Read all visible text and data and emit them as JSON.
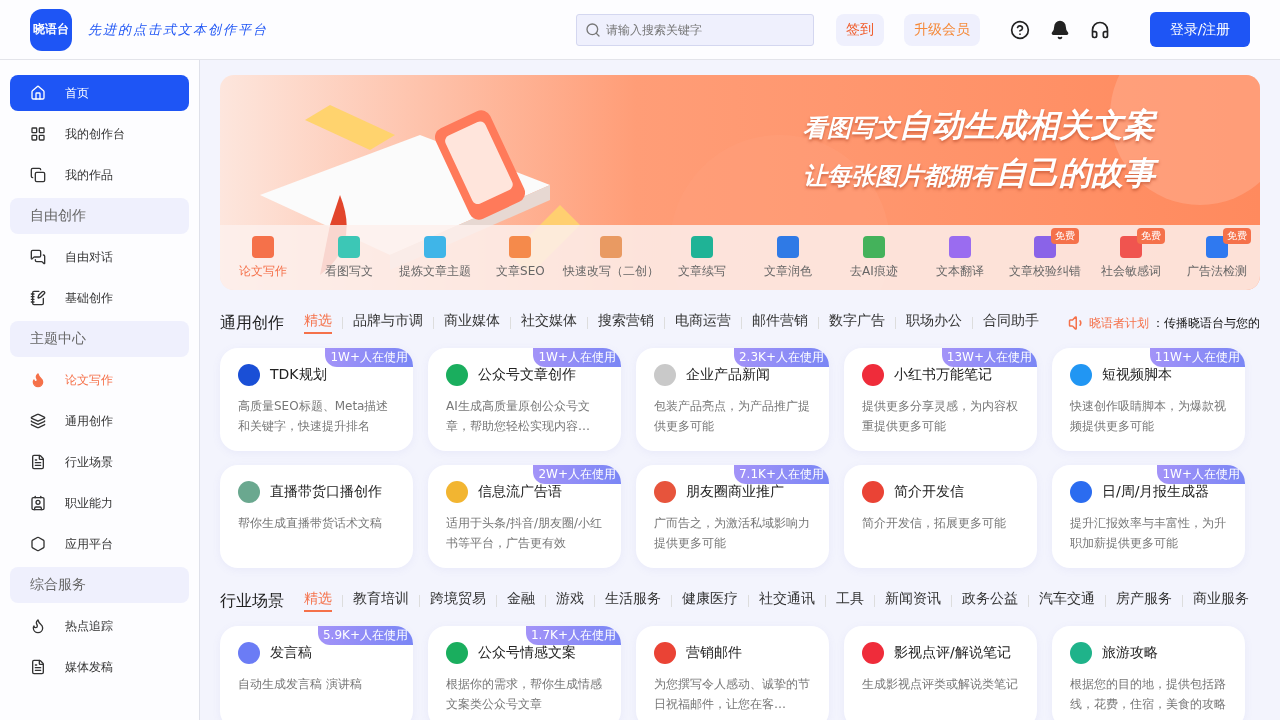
{
  "header": {
    "logo": "晓语台",
    "slogan": "先进的点击式文本创作平台",
    "search": {
      "placeholder": "请输入搜索关键字"
    },
    "checkin": "签到",
    "upgrade": "升级会员",
    "login": "登录/注册"
  },
  "sidebar": {
    "items": [
      {
        "kind": "item",
        "label": "首页",
        "selected": true
      },
      {
        "kind": "item",
        "label": "我的创作台",
        "selected": false
      },
      {
        "kind": "item",
        "label": "我的作品",
        "selected": false
      },
      {
        "kind": "header",
        "label": "自由创作"
      },
      {
        "kind": "item",
        "label": "自由对话",
        "selected": false
      },
      {
        "kind": "item",
        "label": "基础创作",
        "selected": false
      },
      {
        "kind": "header",
        "label": "主题中心"
      },
      {
        "kind": "hot",
        "label": "论文写作",
        "selected": false
      },
      {
        "kind": "item",
        "label": "通用创作",
        "selected": false
      },
      {
        "kind": "item",
        "label": "行业场景",
        "selected": false
      },
      {
        "kind": "item",
        "label": "职业能力",
        "selected": false
      },
      {
        "kind": "item",
        "label": "应用平台",
        "selected": false
      },
      {
        "kind": "header",
        "label": "综合服务"
      },
      {
        "kind": "item",
        "label": "热点追踪",
        "selected": false
      },
      {
        "kind": "item",
        "label": "媒体发稿",
        "selected": false
      }
    ]
  },
  "banner": {
    "line_1": {
      "small": "看图写文",
      "big": "自动生成相关文案"
    },
    "line_2": {
      "small": "让每张图片都拥有",
      "big": "自己的故事"
    },
    "tools": [
      {
        "label": "论文写作",
        "selected": true,
        "color": "#f5714a"
      },
      {
        "label": "看图写文",
        "selected": false,
        "color": "#3cc7b6"
      },
      {
        "label": "提炼文章主题",
        "selected": false,
        "color": "#3fb5e8"
      },
      {
        "label": "文章SEO",
        "selected": false,
        "color": "#f58a4b"
      },
      {
        "label": "快速改写（二创）",
        "selected": false,
        "color": "#e99a62"
      },
      {
        "label": "文章续写",
        "selected": false,
        "color": "#1fb396"
      },
      {
        "label": "文章润色",
        "selected": false,
        "color": "#2f7ae6"
      },
      {
        "label": "去AI痕迹",
        "selected": false,
        "color": "#44b25b"
      },
      {
        "label": "文本翻译",
        "selected": false,
        "color": "#9a6cf0"
      },
      {
        "label": "文章校验纠错",
        "selected": false,
        "color": "#8a63e8",
        "badge": "免费"
      },
      {
        "label": "社会敏感词",
        "selected": false,
        "color": "#f0544f",
        "badge": "免费"
      },
      {
        "label": "广告法检测",
        "selected": false,
        "color": "#2f79f0",
        "badge": "免费"
      }
    ]
  },
  "sections": [
    {
      "title": "通用创作",
      "tabs": [
        {
          "label": "精选",
          "selected": true
        },
        {
          "label": "品牌与市调",
          "selected": false
        },
        {
          "label": "商业媒体",
          "selected": false
        },
        {
          "label": "社交媒体",
          "selected": false
        },
        {
          "label": "搜索营销",
          "selected": false
        },
        {
          "label": "电商运营",
          "selected": false
        },
        {
          "label": "邮件营销",
          "selected": false
        },
        {
          "label": "数字广告",
          "selected": false
        },
        {
          "label": "职场办公",
          "selected": false
        },
        {
          "label": "合同助手",
          "selected": false
        }
      ],
      "notice": {
        "name": "晓语者计划",
        "text": "：传播晓语台与您的"
      },
      "cards": [
        {
          "title": "TDK规划",
          "desc": "高质量SEO标题、Meta描述和关键字，快速提升排名",
          "usage": "1W+人在使用",
          "color": "#1a4fd6"
        },
        {
          "title": "公众号文章创作",
          "desc": "AI生成高质量原创公众号文章，帮助您轻松实现内容…",
          "usage": "1W+人在使用",
          "color": "#1aae5e"
        },
        {
          "title": "企业产品新闻",
          "desc": "包装产品亮点，为产品推广提供更多可能",
          "usage": "2.3K+人在使用",
          "color": "#c9c9c9"
        },
        {
          "title": "小红书万能笔记",
          "desc": "提供更多分享灵感，为内容权重提供更多可能",
          "usage": "13W+人在使用",
          "color": "#ef2c3a"
        },
        {
          "title": "短视频脚本",
          "desc": "快速创作吸睛脚本，为爆款视频提供更多可能",
          "usage": "11W+人在使用",
          "color": "#2196f3"
        },
        {
          "title": "直播带货口播创作",
          "desc": "帮你生成直播带货话术文稿",
          "color": "#6aa88f"
        },
        {
          "title": "信息流广告语",
          "desc": "适用于头条/抖音/朋友圈/小红书等平台，广告更有效",
          "usage": "2W+人在使用",
          "color": "#f2b531"
        },
        {
          "title": "朋友圈商业推广",
          "desc": "广而告之，为激活私域影响力提供更多可能",
          "usage": "7.1K+人在使用",
          "color": "#e7543c"
        },
        {
          "title": "简介开发信",
          "desc": "简介开发信，拓展更多可能",
          "color": "#ea4335"
        },
        {
          "title": "日/周/月报生成器",
          "desc": "提升汇报效率与丰富性，为升职加薪提供更多可能",
          "usage": "1W+人在使用",
          "color": "#2b6cf0"
        }
      ]
    },
    {
      "title": "行业场景",
      "tabs": [
        {
          "label": "精选",
          "selected": true
        },
        {
          "label": "教育培训",
          "selected": false
        },
        {
          "label": "跨境贸易",
          "selected": false
        },
        {
          "label": "金融",
          "selected": false
        },
        {
          "label": "游戏",
          "selected": false
        },
        {
          "label": "生活服务",
          "selected": false
        },
        {
          "label": "健康医疗",
          "selected": false
        },
        {
          "label": "社交通讯",
          "selected": false
        },
        {
          "label": "工具",
          "selected": false
        },
        {
          "label": "新闻资讯",
          "selected": false
        },
        {
          "label": "政务公益",
          "selected": false
        },
        {
          "label": "汽车交通",
          "selected": false
        },
        {
          "label": "房产服务",
          "selected": false
        },
        {
          "label": "商业服务",
          "selected": false
        }
      ],
      "cards": [
        {
          "title": "发言稿",
          "desc": "自动生成发言稿 演讲稿",
          "usage": "5.9K+人在使用",
          "color": "#6b7cf5"
        },
        {
          "title": "公众号情感文案",
          "desc": "根据你的需求，帮你生成情感文案类公众号文章",
          "usage": "1.7K+人在使用",
          "color": "#1aae5e"
        },
        {
          "title": "营销邮件",
          "desc": "为您撰写令人感动、诚挚的节日祝福邮件，让您在客…",
          "color": "#ea4335"
        },
        {
          "title": "影视点评/解说笔记",
          "desc": "生成影视点评类或解说类笔记",
          "color": "#ef2c3a"
        },
        {
          "title": "旅游攻略",
          "desc": "根据您的目的地，提供包括路线，花费，住宿，美食的攻略",
          "color": "#1fb38a"
        }
      ]
    }
  ]
}
